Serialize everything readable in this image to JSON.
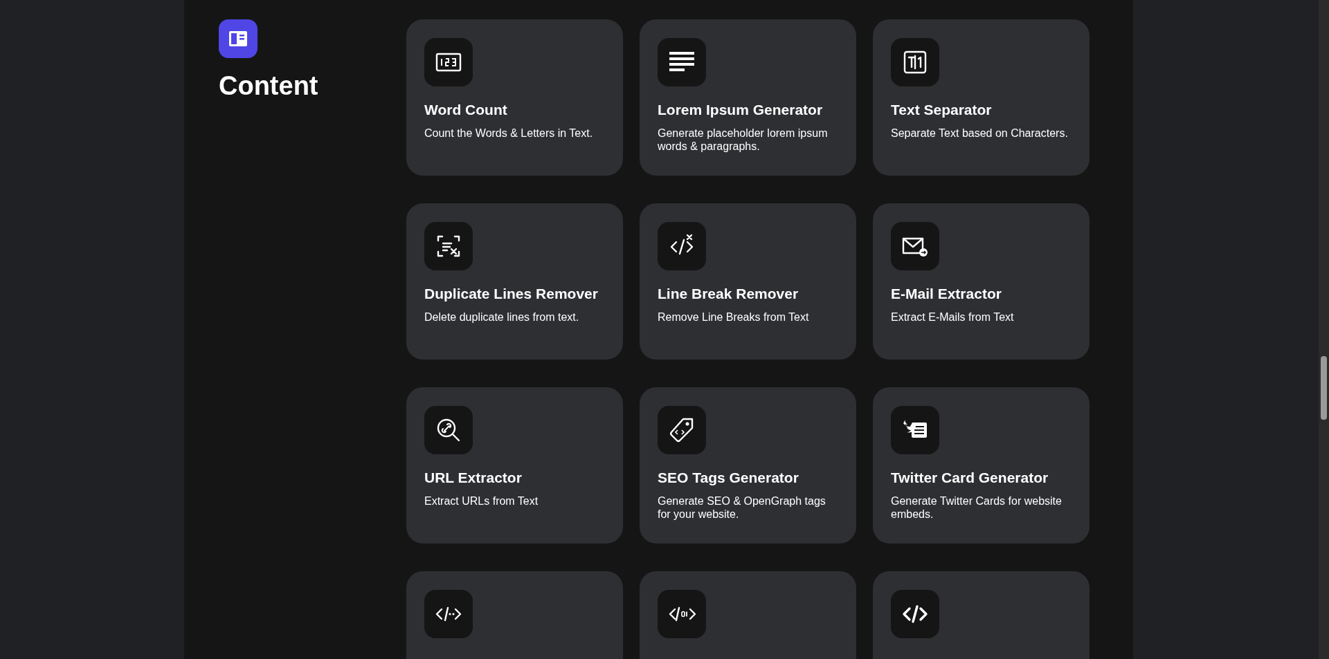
{
  "section": {
    "title": "Content"
  },
  "tools": [
    {
      "kind": "tool",
      "title": "Word Count",
      "description": "Count the Words & Letters in Text."
    },
    {
      "kind": "tool",
      "title": "Lorem Ipsum Generator",
      "description": "Generate placeholder lorem ipsum words & paragraphs."
    },
    {
      "kind": "tool",
      "title": "Text Separator",
      "description": "Separate Text based on Characters."
    },
    {
      "kind": "tool",
      "title": "Duplicate Lines Remover",
      "description": "Delete duplicate lines from text."
    },
    {
      "kind": "tool",
      "title": "Line Break Remover",
      "description": "Remove Line Breaks from Text"
    },
    {
      "kind": "tool",
      "title": "E-Mail Extractor",
      "description": "Extract E-Mails from Text"
    },
    {
      "kind": "tool",
      "title": "URL Extractor",
      "description": "Extract URLs from Text"
    },
    {
      "kind": "tool",
      "title": "SEO Tags Generator",
      "description": "Generate SEO & OpenGraph tags for your website."
    },
    {
      "kind": "tool",
      "title": "Twitter Card Generator",
      "description": "Generate Twitter Cards for website embeds."
    },
    {
      "kind": "clipped"
    },
    {
      "kind": "clipped"
    },
    {
      "kind": "clipped"
    }
  ]
}
